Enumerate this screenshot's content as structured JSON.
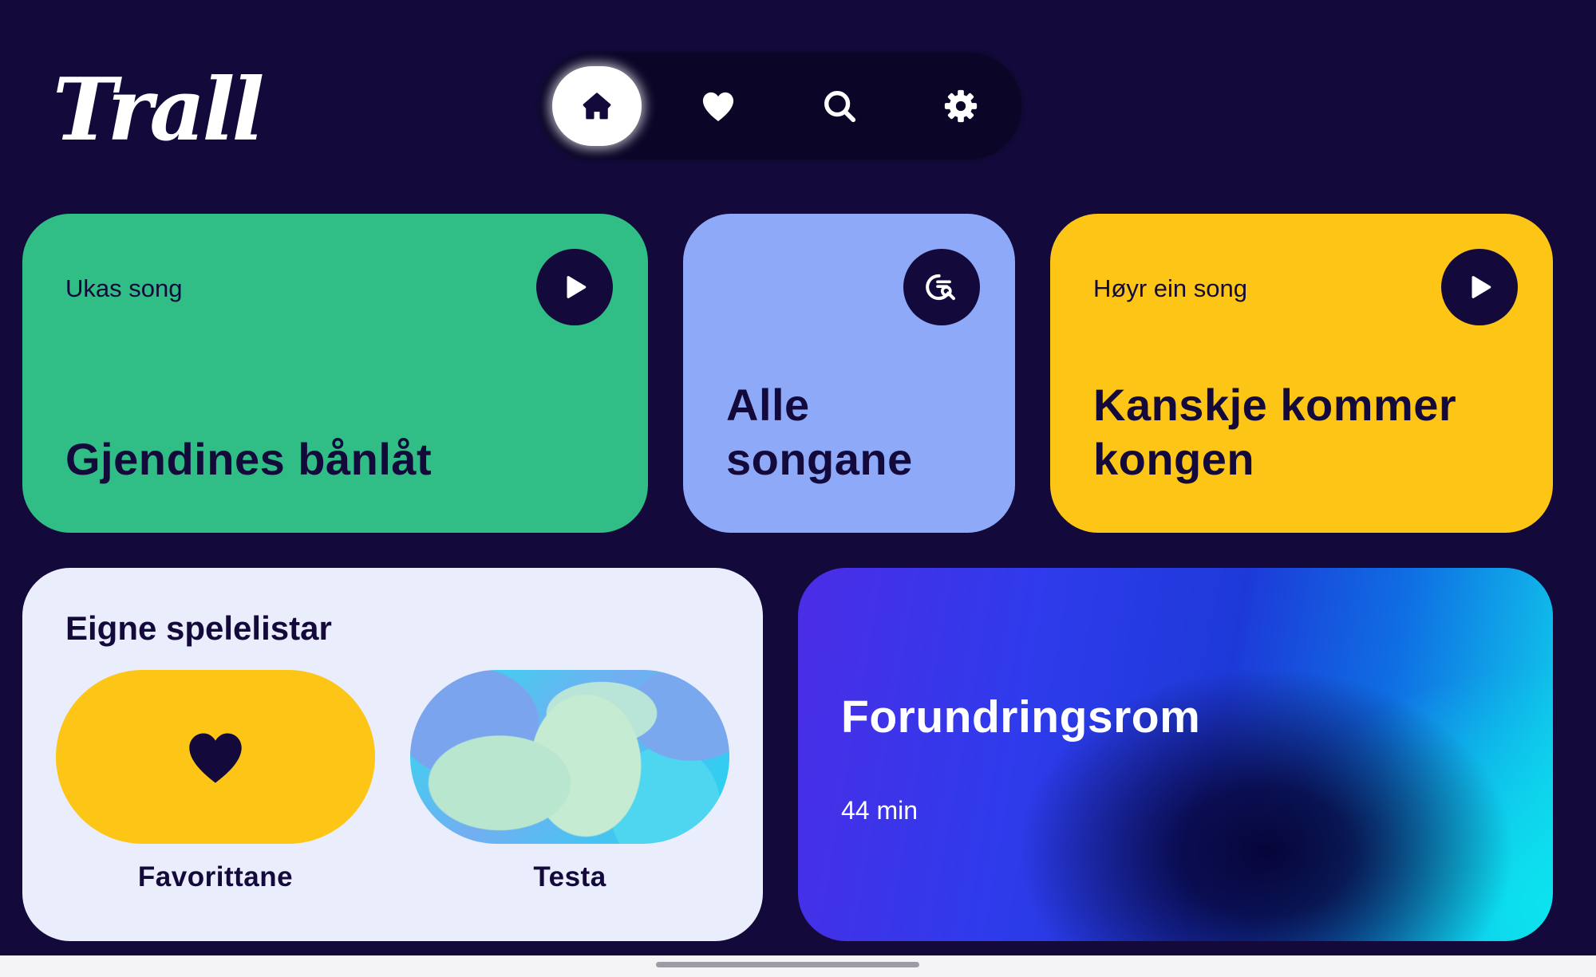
{
  "app": {
    "logo_text": "Trall"
  },
  "nav": {
    "items": [
      {
        "id": "home",
        "icon": "home-icon",
        "active": true
      },
      {
        "id": "favorites",
        "icon": "heart-icon",
        "active": false
      },
      {
        "id": "search",
        "icon": "search-icon",
        "active": false
      },
      {
        "id": "settings",
        "icon": "gear-icon",
        "active": false
      }
    ]
  },
  "cards": {
    "weekly_song": {
      "eyebrow": "Ukas song",
      "title": "Gjendines bånlåt",
      "color": "#31bd86",
      "action_icon": "play-icon"
    },
    "all_songs": {
      "title_line1": "Alle",
      "title_line2": "songane",
      "color": "#8ea9f8",
      "action_icon": "list-search-icon"
    },
    "listen": {
      "eyebrow": "Høyr ein song",
      "title_line1": "Kanskje kommer",
      "title_line2": "kongen",
      "color": "#fdc516",
      "action_icon": "play-icon"
    }
  },
  "playlists": {
    "title": "Eigne spelelistar",
    "items": [
      {
        "label": "Favorittane",
        "icon": "heart-icon"
      },
      {
        "label": "Testa"
      }
    ]
  },
  "featured": {
    "title": "Forundringsrom",
    "duration": "44 min"
  },
  "colors": {
    "background": "#130a3b",
    "text_dark": "#130a3b",
    "white": "#ffffff"
  }
}
